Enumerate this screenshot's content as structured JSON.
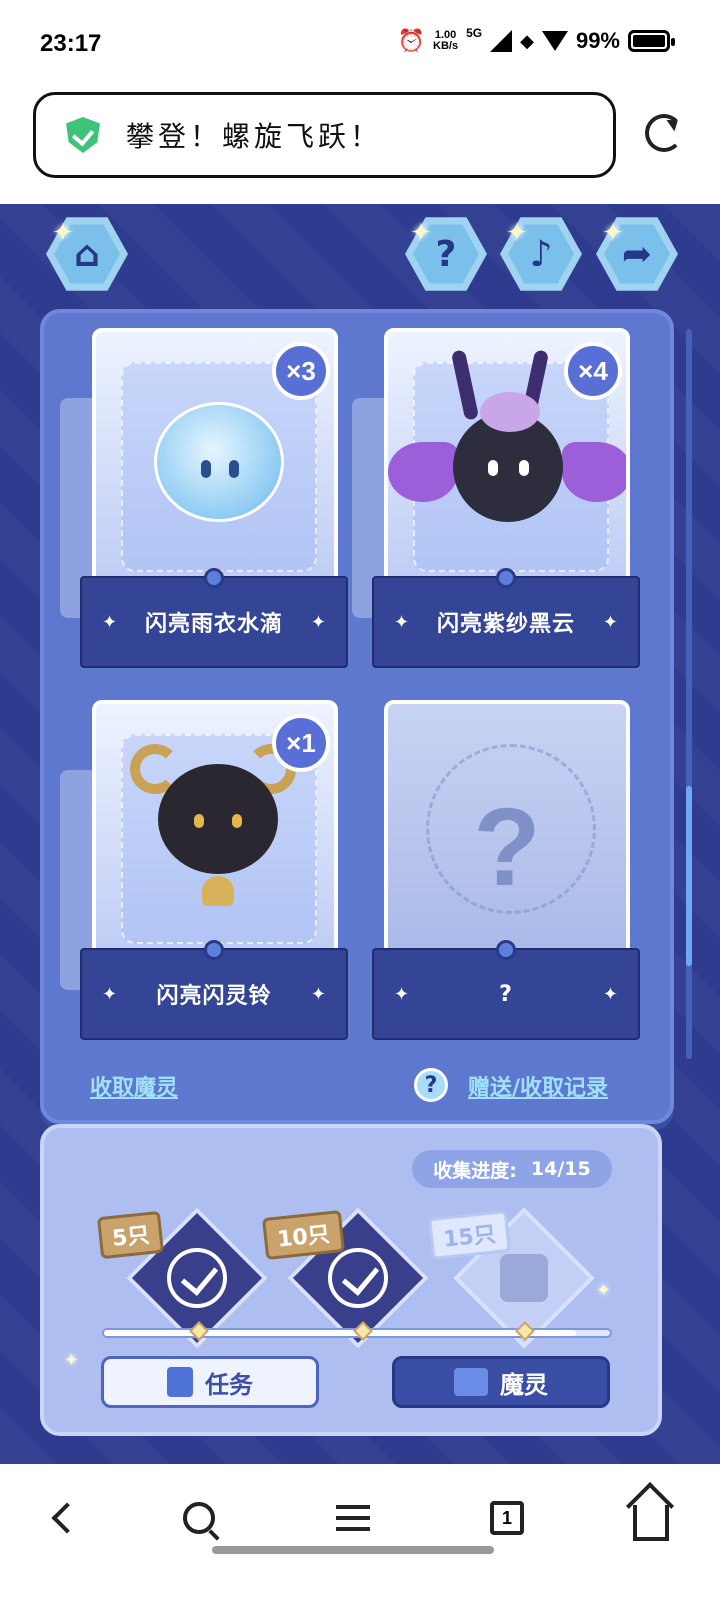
{
  "status_bar": {
    "time": "23:17",
    "net_speed_value": "1.00",
    "net_speed_unit": "KB/s",
    "network": "5G",
    "battery": "99%"
  },
  "browser": {
    "page_title": "攀登！螺旋飞跃！"
  },
  "game": {
    "cards": [
      {
        "name": "闪亮雨衣水滴",
        "count": "×3"
      },
      {
        "name": "闪亮紫纱黑云",
        "count": "×4"
      },
      {
        "name": "闪亮闪灵铃",
        "count": "×1"
      },
      {
        "name": "?",
        "count": ""
      }
    ],
    "collect_link": "收取魔灵",
    "help_glyph": "?",
    "records_link": "赠送/收取记录",
    "progress_label": "收集进度:",
    "progress_value": "14/15",
    "progress_fraction": 0.9333,
    "milestones": [
      {
        "label": "5只",
        "completed": true
      },
      {
        "label": "10只",
        "completed": true
      },
      {
        "label": "15只",
        "completed": false
      }
    ],
    "task_button": "任务",
    "spirit_button": "魔灵"
  },
  "nav": {
    "tab_count": "1"
  },
  "colors": {
    "game_bg": "#2e3b8f",
    "panel": "#5f78cf",
    "accent_green": "#3ec47a"
  }
}
